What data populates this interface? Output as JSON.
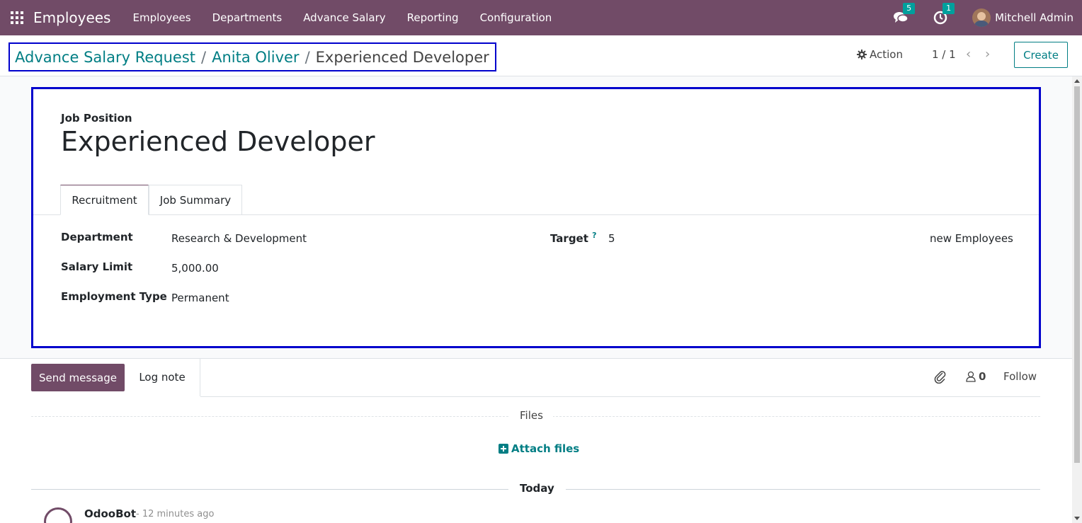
{
  "navbar": {
    "brand": "Employees",
    "menu": [
      "Employees",
      "Departments",
      "Advance Salary",
      "Reporting",
      "Configuration"
    ],
    "messages_count": "5",
    "activities_count": "1",
    "user": "Mitchell Admin"
  },
  "breadcrumb": {
    "items": [
      "Advance Salary Request",
      "Anita Oliver",
      "Experienced Developer"
    ],
    "separator": "/"
  },
  "control": {
    "action_label": "Action",
    "pager": "1 / 1",
    "create_label": "Create"
  },
  "form": {
    "title_label": "Job Position",
    "title": "Experienced Developer",
    "tabs": [
      "Recruitment",
      "Job Summary"
    ],
    "fields": {
      "department_label": "Department",
      "department_value": "Research & Development",
      "salary_limit_label": "Salary Limit",
      "salary_limit_value": "5,000.00",
      "employment_type_label": "Employment Type",
      "employment_type_value": "Permanent",
      "target_label": "Target",
      "target_help": "?",
      "target_value": "5",
      "target_suffix": "new Employees"
    }
  },
  "chatter": {
    "send_message": "Send message",
    "log_note": "Log note",
    "followers_count": "0",
    "follow_label": "Follow",
    "files_title": "Files",
    "attach_files": "Attach files",
    "today_label": "Today",
    "message_author": "OdooBot",
    "message_time": "- 12 minutes ago"
  },
  "colors": {
    "brand": "#714b67",
    "accent": "#017e84",
    "highlight_border": "#0000cc"
  }
}
